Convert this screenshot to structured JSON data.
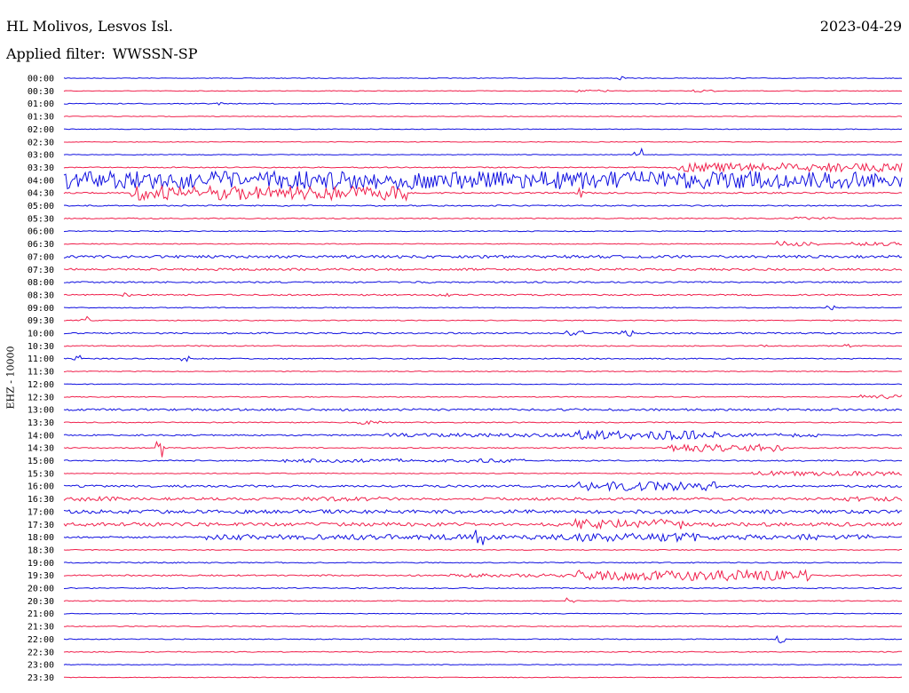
{
  "header": {
    "station": "HL Molivos, Lesvos Isl.",
    "date": "2023-04-29",
    "filter_label": "Applied filter:",
    "filter_value": "WWSSN-SP"
  },
  "colors": {
    "trace_a": "#1010e0",
    "trace_b": "#f0204c",
    "text": "#000000"
  },
  "chart_data": {
    "type": "line",
    "title": "HL Molivos, Lesvos Isl.",
    "subtitle": "Applied filter: WWSSN-SP",
    "ylabel": "EHZ - 10000",
    "grid": false,
    "y_tick_labels": [
      "00:00",
      "00:30",
      "01:00",
      "01:30",
      "02:00",
      "02:30",
      "03:00",
      "03:30",
      "04:00",
      "04:30",
      "05:00",
      "05:30",
      "06:00",
      "06:30",
      "07:00",
      "07:30",
      "08:00",
      "08:30",
      "09:00",
      "09:30",
      "10:00",
      "10:30",
      "11:00",
      "11:30",
      "12:00",
      "12:30",
      "13:00",
      "13:30",
      "14:00",
      "14:30",
      "15:00",
      "15:30",
      "16:00",
      "16:30",
      "17:00",
      "17:30",
      "18:00",
      "18:30",
      "19:00",
      "19:30",
      "20:00",
      "20:30",
      "21:00",
      "21:30",
      "22:00",
      "22:30",
      "23:00",
      "23:30"
    ],
    "series": [
      {
        "row": "00:00",
        "base": 0.4,
        "bursts": [
          [
            66,
            67,
            2.5
          ]
        ]
      },
      {
        "row": "00:30",
        "base": 0.4,
        "bursts": [
          [
            61,
            65,
            1.2
          ],
          [
            75,
            78,
            1.5
          ]
        ]
      },
      {
        "row": "01:00",
        "base": 0.5,
        "bursts": [
          [
            18,
            19,
            1.5
          ]
        ]
      },
      {
        "row": "01:30",
        "base": 0.4,
        "bursts": []
      },
      {
        "row": "02:00",
        "base": 0.4,
        "bursts": []
      },
      {
        "row": "02:30",
        "base": 0.4,
        "bursts": []
      },
      {
        "row": "03:00",
        "base": 0.4,
        "bursts": [
          [
            68,
            69,
            7
          ]
        ]
      },
      {
        "row": "03:30",
        "base": 0.6,
        "bursts": [
          [
            73,
            100,
            5
          ]
        ]
      },
      {
        "row": "04:00",
        "base": 8,
        "bursts": [
          [
            0,
            95,
            10
          ]
        ]
      },
      {
        "row": "04:30",
        "base": 0.8,
        "bursts": [
          [
            8,
            41,
            8
          ],
          [
            61,
            62,
            6
          ]
        ]
      },
      {
        "row": "05:00",
        "base": 0.7,
        "bursts": []
      },
      {
        "row": "05:30",
        "base": 0.6,
        "bursts": [
          [
            87,
            92,
            1.5
          ]
        ]
      },
      {
        "row": "06:00",
        "base": 0.5,
        "bursts": []
      },
      {
        "row": "06:30",
        "base": 0.5,
        "bursts": [
          [
            85,
            90,
            3
          ],
          [
            94,
            100,
            2
          ]
        ]
      },
      {
        "row": "07:00",
        "base": 1.5,
        "bursts": []
      },
      {
        "row": "07:30",
        "base": 1.2,
        "bursts": []
      },
      {
        "row": "08:00",
        "base": 0.8,
        "bursts": [
          [
            42,
            44,
            2
          ]
        ]
      },
      {
        "row": "08:30",
        "base": 0.8,
        "bursts": [
          [
            7,
            8,
            3
          ],
          [
            44,
            46,
            2
          ]
        ]
      },
      {
        "row": "09:00",
        "base": 0.5,
        "bursts": [
          [
            91,
            92,
            3
          ]
        ]
      },
      {
        "row": "09:30",
        "base": 0.5,
        "bursts": [
          [
            2,
            3,
            5
          ]
        ]
      },
      {
        "row": "10:00",
        "base": 0.8,
        "bursts": [
          [
            60,
            62,
            3
          ],
          [
            66,
            68,
            4
          ]
        ]
      },
      {
        "row": "10:30",
        "base": 0.6,
        "bursts": [
          [
            83,
            84,
            3
          ],
          [
            93,
            94,
            2
          ]
        ]
      },
      {
        "row": "11:00",
        "base": 0.6,
        "bursts": [
          [
            1,
            2,
            4
          ],
          [
            14,
            15,
            4
          ]
        ]
      },
      {
        "row": "11:30",
        "base": 0.5,
        "bursts": []
      },
      {
        "row": "12:00",
        "base": 0.4,
        "bursts": []
      },
      {
        "row": "12:30",
        "base": 0.5,
        "bursts": [
          [
            95,
            100,
            2.5
          ]
        ]
      },
      {
        "row": "13:00",
        "base": 1.2,
        "bursts": []
      },
      {
        "row": "13:30",
        "base": 0.6,
        "bursts": [
          [
            35,
            38,
            2
          ]
        ]
      },
      {
        "row": "14:00",
        "base": 0.8,
        "bursts": [
          [
            38,
            61,
            2
          ],
          [
            61,
            78,
            5
          ],
          [
            78,
            90,
            2
          ]
        ]
      },
      {
        "row": "14:30",
        "base": 0.6,
        "bursts": [
          [
            11,
            12,
            14
          ],
          [
            72,
            86,
            4
          ]
        ]
      },
      {
        "row": "15:00",
        "base": 0.7,
        "bursts": [
          [
            26,
            55,
            2
          ]
        ]
      },
      {
        "row": "15:30",
        "base": 0.5,
        "bursts": [
          [
            82,
            100,
            2.5
          ]
        ]
      },
      {
        "row": "16:00",
        "base": 1.2,
        "bursts": [
          [
            61,
            78,
            5
          ]
        ]
      },
      {
        "row": "16:30",
        "base": 1.5,
        "bursts": [
          [
            0,
            7,
            2.5
          ],
          [
            28,
            39,
            2.5
          ],
          [
            93,
            100,
            2.5
          ]
        ]
      },
      {
        "row": "17:00",
        "base": 2,
        "bursts": []
      },
      {
        "row": "17:30",
        "base": 1.5,
        "bursts": [
          [
            0,
            49,
            2
          ],
          [
            57,
            100,
            2
          ],
          [
            61,
            74,
            6
          ]
        ]
      },
      {
        "row": "18:00",
        "base": 1,
        "bursts": [
          [
            17,
            96,
            3
          ],
          [
            49,
            50,
            10
          ],
          [
            61,
            76,
            5
          ]
        ]
      },
      {
        "row": "18:30",
        "base": 0.5,
        "bursts": []
      },
      {
        "row": "19:00",
        "base": 0.6,
        "bursts": []
      },
      {
        "row": "19:30",
        "base": 0.8,
        "bursts": [
          [
            46,
            61,
            2
          ],
          [
            61,
            89,
            6
          ]
        ]
      },
      {
        "row": "20:00",
        "base": 0.6,
        "bursts": []
      },
      {
        "row": "20:30",
        "base": 0.5,
        "bursts": [
          [
            60,
            61,
            6
          ]
        ]
      },
      {
        "row": "21:00",
        "base": 0.4,
        "bursts": []
      },
      {
        "row": "21:30",
        "base": 0.5,
        "bursts": []
      },
      {
        "row": "22:00",
        "base": 0.5,
        "bursts": [
          [
            85,
            86,
            5
          ]
        ]
      },
      {
        "row": "22:30",
        "base": 0.5,
        "bursts": []
      },
      {
        "row": "23:00",
        "base": 0.4,
        "bursts": []
      },
      {
        "row": "23:30",
        "base": 0.4,
        "bursts": []
      }
    ]
  }
}
